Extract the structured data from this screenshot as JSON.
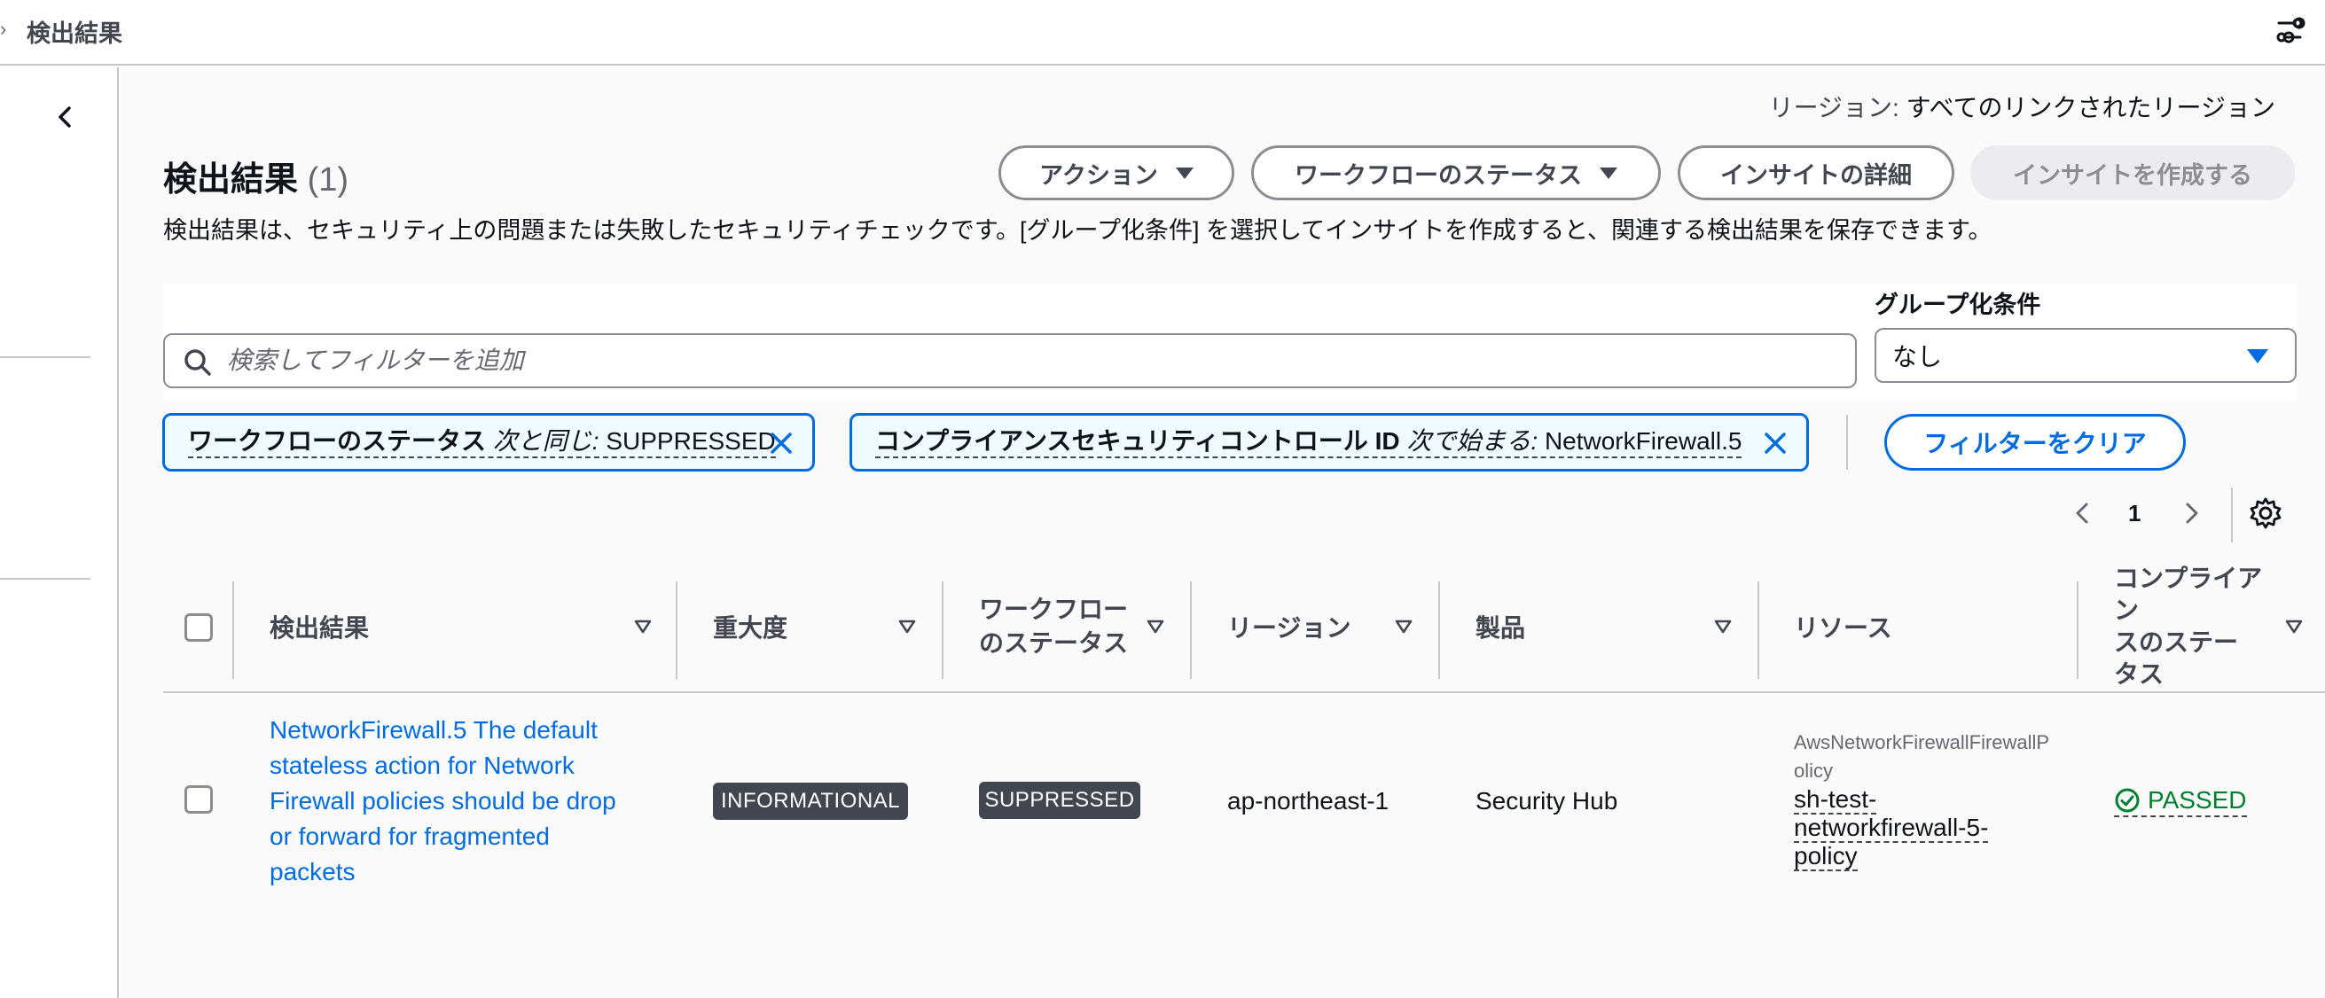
{
  "breadcrumb": {
    "current": "検出結果"
  },
  "header": {
    "region_label": "リージョン:",
    "region_value": "すべてのリンクされたリージョン",
    "title": "検出結果",
    "count": "(1)",
    "description": "検出結果は、セキュリティ上の問題または失敗したセキュリティチェックです。[グループ化条件] を選択してインサイトを作成すると、関連する検出結果を保存できます。"
  },
  "actions": {
    "action_label": "アクション",
    "workflow_label": "ワークフローのステータス",
    "insight_details_label": "インサイトの詳細",
    "create_insight_label": "インサイトを作成する"
  },
  "search": {
    "placeholder": "検索してフィルターを追加"
  },
  "group_by": {
    "label": "グループ化条件",
    "value": "なし"
  },
  "filters": [
    {
      "key": "ワークフローのステータス",
      "operator": "次と同じ:",
      "value": "SUPPRESSED"
    },
    {
      "key": "コンプライアンスセキュリティコントロール ID",
      "operator": "次で始まる:",
      "value": "NetworkFirewall.5"
    }
  ],
  "clear_filters_label": "フィルターをクリア",
  "pagination": {
    "current_page": "1"
  },
  "table": {
    "columns": {
      "finding": "検出結果",
      "severity": "重大度",
      "workflow_line1": "ワークフロー",
      "workflow_line2": "のステータス",
      "region": "リージョン",
      "product": "製品",
      "resource": "リソース",
      "compliance_line1": "コンプライアン",
      "compliance_line2": "スのステー",
      "compliance_line3": "タス"
    },
    "rows": [
      {
        "finding": "NetworkFirewall.5 The default stateless action for Network Firewall policies should be drop or forward for fragmented packets",
        "severity": "INFORMATIONAL",
        "workflow_status": "SUPPRESSED",
        "region": "ap-northeast-1",
        "product": "Security Hub",
        "resource_type": "AwsNetworkFirewallFirewallPolicy",
        "resource_id": "sh-test-networkfirewall-5-policy",
        "compliance_status": "PASSED"
      }
    ]
  },
  "colors": {
    "accent": "#006ce0",
    "badge_bg": "#424650",
    "passed": "#00802f",
    "token_bg": "#f0fbff"
  }
}
